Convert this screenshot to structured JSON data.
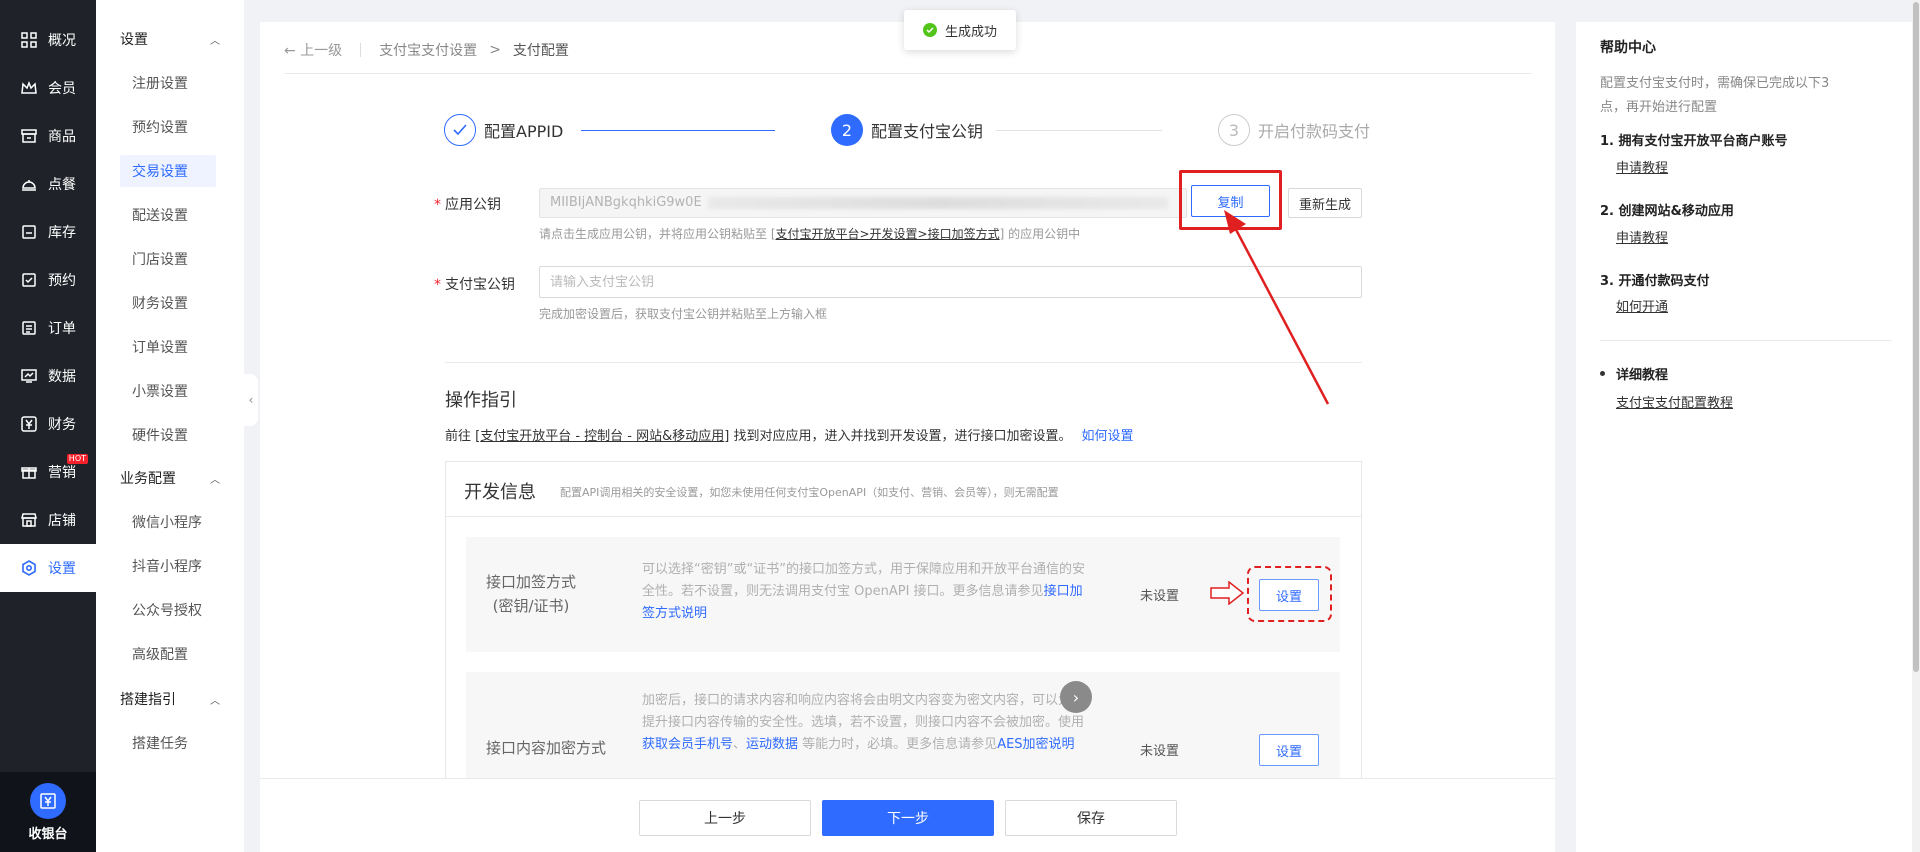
{
  "nav": {
    "items": [
      {
        "label": "概况",
        "icon": "grid-icon"
      },
      {
        "label": "会员",
        "icon": "crown-icon"
      },
      {
        "label": "商品",
        "icon": "shop-icon"
      },
      {
        "label": "点餐",
        "icon": "dish-icon"
      },
      {
        "label": "库存",
        "icon": "box-icon"
      },
      {
        "label": "预约",
        "icon": "calendar-check-icon"
      },
      {
        "label": "订单",
        "icon": "order-list-icon"
      },
      {
        "label": "数据",
        "icon": "chart-icon"
      },
      {
        "label": "财务",
        "icon": "yuan-icon"
      },
      {
        "label": "营销",
        "icon": "gift-icon",
        "badge": "HOT"
      },
      {
        "label": "店铺",
        "icon": "store-icon"
      },
      {
        "label": "设置",
        "icon": "gear-icon",
        "active": true
      }
    ],
    "cashier_label": "收银台"
  },
  "subnav": {
    "groups": [
      {
        "label": "设置",
        "items": [
          "注册设置",
          "预约设置",
          "交易设置",
          "配送设置",
          "门店设置",
          "财务设置",
          "订单设置",
          "小票设置",
          "硬件设置"
        ]
      },
      {
        "label": "业务配置",
        "items": [
          "微信小程序",
          "抖音小程序",
          "公众号授权",
          "高级配置"
        ]
      },
      {
        "label": "搭建指引",
        "items": [
          "搭建任务"
        ]
      }
    ],
    "active_item": "交易设置"
  },
  "toast": {
    "text": "生成成功"
  },
  "breadcrumb": {
    "back": "上一级",
    "parent": "支付宝支付设置",
    "separator": ">",
    "current": "支付配置"
  },
  "steps": [
    {
      "label": "配置APPID",
      "number": "1"
    },
    {
      "label": "配置支付宝公钥",
      "number": "2"
    },
    {
      "label": "开启付款码支付",
      "number": "3"
    }
  ],
  "form": {
    "app_key": {
      "label": "应用公钥",
      "value_prefix": "MIIBIjANBgkqhkiG9w0E",
      "copy_label": "复制",
      "regen_label": "重新生成",
      "hint_before": "请点击生成应用公钥，并将应用公钥粘贴至 [",
      "hint_link": "支付宝开放平台>开发设置>接口加签方式",
      "hint_after": "] 的应用公钥中"
    },
    "alipay_key": {
      "label": "支付宝公钥",
      "placeholder": "请输入支付宝公钥",
      "hint": "完成加密设置后，获取支付宝公钥并粘贴至上方输入框"
    }
  },
  "guide": {
    "title": "操作指引",
    "text_before": "前往 [",
    "link": "支付宝开放平台 - 控制台 - 网站&移动应用",
    "text_after": "] 找到对应应用，进入并找到开发设置，进行接口加密设置。",
    "how_link": "如何设置"
  },
  "dev_info": {
    "title": "开发信息",
    "subtitle": "配置API调用相关的安全设置，如您未使用任何支付宝OpenAPI（如支付、营销、会员等），则无需配置",
    "rows": [
      {
        "title_line1": "接口加签方式",
        "title_line2": "(密钥/证书)",
        "desc": "可以选择“密钥”或“证书”的接口加签方式，用于保障应用和开放平台通信的安全性。若不设置，则无法调用支付宝 OpenAPI 接口。更多信息请参见",
        "desc_link": "接口加签方式说明",
        "status": "未设置",
        "button": "设置"
      },
      {
        "title_line1": "接口内容加密方式",
        "desc_part1": "加密后，接口的请求内容和响应内容将会由明文内容变为密文内容，可以大大提升接口内容传输的安全性。选填，若不设置，则接口内容不会被加密。使用 ",
        "desc_link1": "获取会员手机号",
        "desc_sep": "、",
        "desc_link2": "运动数据",
        "desc_part2": " 等能力时，必填。更多信息请参见",
        "desc_link3": "AES加密说明",
        "status": "未设置",
        "button": "设置"
      }
    ]
  },
  "footer": {
    "prev": "上一步",
    "next": "下一步",
    "save": "保存"
  },
  "help": {
    "title": "帮助中心",
    "intro": "配置支付宝支付时，需确保已完成以下3点，再开始进行配置",
    "steps": [
      {
        "title": "1. 拥有支付宝开放平台商户账号",
        "link": "申请教程"
      },
      {
        "title": "2. 创建网站&移动应用",
        "link": "申请教程"
      },
      {
        "title": "3. 开通付款码支付",
        "link": "如何开通"
      }
    ],
    "detail_title": "详细教程",
    "detail_link": "支付宝支付配置教程"
  },
  "colors": {
    "primary": "#2f6bff",
    "nav_bg": "#1f2329",
    "annotation_red": "#e02020",
    "success": "#52c41a"
  }
}
